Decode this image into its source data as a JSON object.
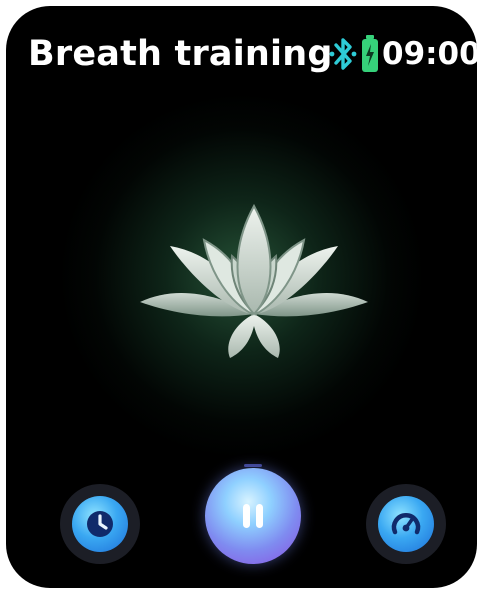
{
  "app": {
    "title": "Breath training"
  },
  "status": {
    "time": "09:00",
    "bluetooth_icon": "bluetooth-icon",
    "battery_icon": "battery-charging-icon",
    "accent_color": "#2ecbd6"
  },
  "main": {
    "visual_icon": "lotus-icon",
    "glow_color": "#3f8f63"
  },
  "controls": {
    "timer_button_icon": "clock-icon",
    "pause_button_icon": "pause-icon",
    "speed_button_icon": "gauge-icon",
    "button_color": "#3aa8f2"
  }
}
